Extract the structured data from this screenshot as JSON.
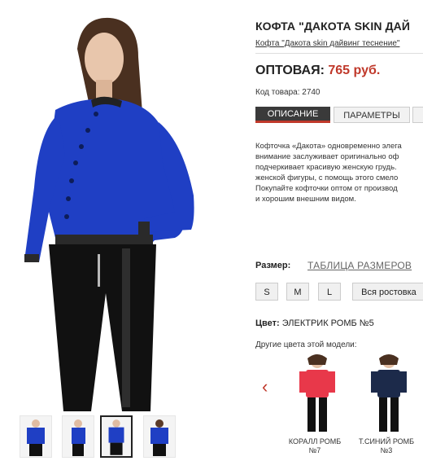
{
  "product": {
    "title": "КОФТА \"ДАКОТА SKIN ДАЙ",
    "subtitle": "Кофта \"Дакота skin дайвинг теснение\"",
    "price_label": "ОПТОВАЯ:",
    "price_value": "765 руб.",
    "sku": "Код товара: 2740"
  },
  "tabs": [
    {
      "label": "ОПИСАНИЕ",
      "active": true
    },
    {
      "label": "ПАРАМЕТРЫ",
      "active": false
    }
  ],
  "description_lines": [
    "Кофточка «Дакота» одновременно элега",
    "внимание заслуживает оригинально оф",
    "подчеркивает красивую женскую грудь.",
    "женской фигуры, с помощь этого смело",
    "Покупайте кофточки оптом от производ",
    "и хорошим внешним видом."
  ],
  "size": {
    "label": "Размер:",
    "table_link": "ТАБЛИЦА РАЗМЕРОВ",
    "options": [
      "S",
      "M",
      "L"
    ],
    "all_label": "Вся ростовка"
  },
  "color": {
    "label": "Цвет:",
    "value": "ЭЛЕКТРИК РОМБ №5",
    "other_label": "Другие цвета этой модели:"
  },
  "variants": [
    {
      "name_line1": "КОРАЛЛ РОМБ",
      "name_line2": "№7"
    },
    {
      "name_line1": "Т.СИНИЙ РОМБ",
      "name_line2": "№3"
    }
  ],
  "colors": {
    "accent": "#c0392b",
    "jacket_blue": "#1f3fc4",
    "coral": "#e8384a",
    "navy": "#1c2a4a"
  }
}
